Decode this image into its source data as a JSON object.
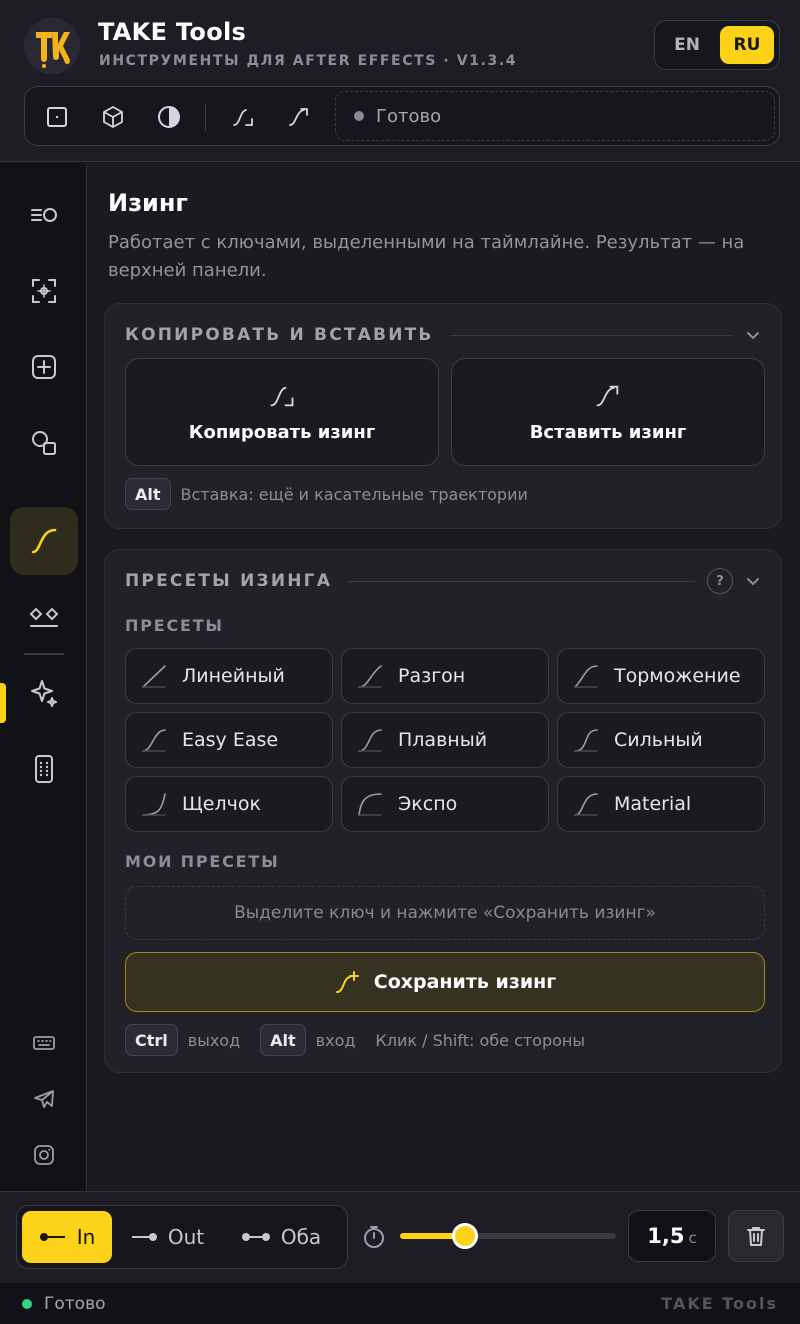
{
  "header": {
    "title": "TAKE Tools",
    "subtitle": "ИНСТРУМЕНТЫ ДЛЯ AFTER EFFECTS · V1.3.4",
    "lang": [
      "EN",
      "RU"
    ],
    "lang_active": "RU",
    "toolbar_status": "Готово"
  },
  "toolbar_icons": [
    "anchor-center-icon",
    "cube-icon",
    "contrast-icon",
    "ease-copy-icon",
    "ease-paste-icon"
  ],
  "sidebar_icons": [
    "align-icon",
    "focus-icon",
    "add-icon",
    "shapes-icon",
    "easing-curve-icon",
    "eye-icon",
    "sparkle-icon",
    "device-icon",
    "keyboard-icon",
    "telegram-icon",
    "instagram-icon"
  ],
  "main": {
    "title": "Изинг",
    "description": "Работает с ключами, выделенными на таймлайне. Результат — на верхней панели."
  },
  "copy_paste": {
    "header": "КОПИРОВАТЬ И ВСТАВИТЬ",
    "copy_label": "Копировать изинг",
    "paste_label": "Вставить изинг",
    "hint_key": "Alt",
    "hint_text": "Вставка: ещё и касательные траектории"
  },
  "presets": {
    "header": "ПРЕСЕТЫ ИЗИНГА",
    "help": "?",
    "subheader": "ПРЕСЕТЫ",
    "items": [
      "Линейный",
      "Разгон",
      "Торможение",
      "Easy Ease",
      "Плавный",
      "Сильный",
      "Щелчок",
      "Экспо",
      "Material"
    ],
    "my_header": "МОИ ПРЕСЕТЫ",
    "my_empty": "Выделите ключ и нажмите «Сохранить изинг»",
    "save_label": "Сохранить изинг",
    "hint_ctrl": "Ctrl",
    "hint_ctrl_text": "выход",
    "hint_alt": "Alt",
    "hint_alt_text": "вход",
    "hint_click": "Клик / Shift: обе стороны"
  },
  "bottom": {
    "modes": [
      "In",
      "Out",
      "Оба"
    ],
    "mode_active": "In",
    "slider_fraction": 0.3,
    "duration_value": "1,5",
    "duration_unit": "с"
  },
  "statusbar": {
    "status": "Готово",
    "brand": "TAKE Tools"
  },
  "colors": {
    "accent": "#fdd319",
    "background": "#1b1a20",
    "status_ok": "#34d27b"
  }
}
